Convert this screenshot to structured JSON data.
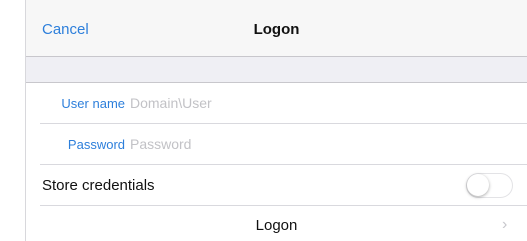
{
  "navbar": {
    "cancel_label": "Cancel",
    "title": "Logon"
  },
  "form": {
    "username": {
      "label": "User name",
      "value": "",
      "placeholder": "Domain\\User"
    },
    "password": {
      "label": "Password",
      "value": "",
      "placeholder": "Password"
    },
    "store_credentials": {
      "label": "Store credentials",
      "enabled": false
    },
    "logon_button": {
      "label": "Logon",
      "icon": "chevron-right-icon"
    }
  },
  "colors": {
    "accent": "#2d7fdb",
    "nav_background": "#f7f7f7",
    "group_background": "#efeff4",
    "placeholder": "#c2c2c6"
  }
}
